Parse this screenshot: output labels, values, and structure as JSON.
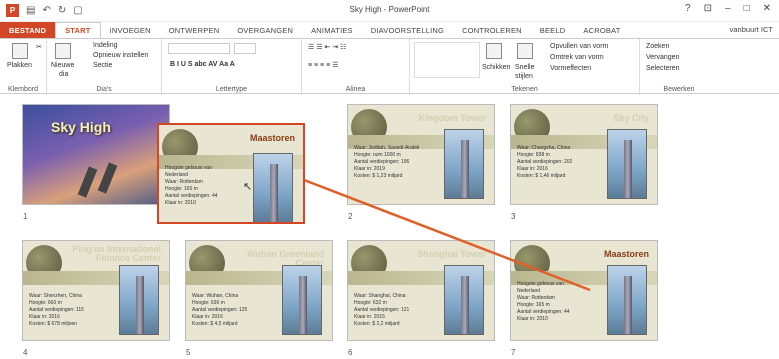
{
  "window": {
    "title": "Sky High - PowerPoint",
    "user": "vanbuurt ICT"
  },
  "tabs": [
    {
      "label": "BESTAND"
    },
    {
      "label": "START"
    },
    {
      "label": "INVOEGEN"
    },
    {
      "label": "ONTWERPEN"
    },
    {
      "label": "OVERGANGEN"
    },
    {
      "label": "ANIMATIES"
    },
    {
      "label": "DIAVOORSTELLING"
    },
    {
      "label": "CONTROLEREN"
    },
    {
      "label": "BEELD"
    },
    {
      "label": "ACROBAT"
    }
  ],
  "ribbon": {
    "klembord": {
      "label": "Klembord",
      "plakken": "Plakken"
    },
    "dias": {
      "label": "Dia's",
      "nieuwe": "Nieuwe",
      "dia": "dia",
      "indeling": "Indeling",
      "opnieuw": "Opnieuw instellen",
      "sectie": "Sectie"
    },
    "lettertype": {
      "label": "Lettertype"
    },
    "alinea": {
      "label": "Alinea"
    },
    "tekenen": {
      "label": "Tekenen",
      "schikken": "Schikken",
      "snelle": "Snelle",
      "stijlen": "stijlen",
      "opvullen": "Opvullen van vorm",
      "omtrek": "Omtrek van vorm",
      "effecten": "Vormeffecten"
    },
    "bewerken": {
      "label": "Bewerken",
      "zoeken": "Zoeken",
      "vervangen": "Vervangen",
      "selecteren": "Selecteren"
    }
  },
  "slides": [
    {
      "num": "1",
      "title": "Sky High"
    },
    {
      "num": "2",
      "title": "Kingdom Tower",
      "bullets": [
        "Waar: Jeddah, Saoedi-Arabië",
        "Hoogte: ruim 1000 m",
        "Aantal verdiepingen: 196",
        "Klaar in: 2019",
        "Kosten: $ 1,23 miljard"
      ]
    },
    {
      "num": "3",
      "title": "Sky City",
      "bullets": [
        "Waar: Changsha, China",
        "Hoogte: 838 m",
        "Aantal verdiepingen: 202",
        "Klaar in: 2016",
        "Kosten: $ 1,46 miljard"
      ]
    },
    {
      "num": "4",
      "title": "Ping'an International Finance Center",
      "bullets": [
        "Waar: Shenzhen, China",
        "Hoogte: 660 m",
        "Aantal verdiepingen: 115",
        "Klaar in: 2016",
        "Kosten: $ 678 miljoen"
      ]
    },
    {
      "num": "5",
      "title": "Wuhan Greenland Center",
      "bullets": [
        "Waar: Wuhan, China",
        "Hoogte: 636 m",
        "Aantal verdiepingen: 125",
        "Klaar in: 2016",
        "Kosten: $ 4,5 miljard"
      ]
    },
    {
      "num": "6",
      "title": "Shanghai Tower",
      "bullets": [
        "Waar: Shanghai, China",
        "Hoogte: 632 m",
        "Aantal verdiepingen: 121",
        "Klaar in: 2015",
        "Kosten: $ 2,2 miljard"
      ]
    },
    {
      "num": "7",
      "title": "Maastoren",
      "bullets": [
        "Hoogste gebouw van Nederland",
        "Waar: Rotterdam",
        "Hoogte: 165 m",
        "Aantal verdiepingen: 44",
        "Klaar in: 2010"
      ]
    }
  ],
  "dragged": {
    "title": "Maastoren",
    "bullets": [
      "Hoogste gebouw van Nederland",
      "Waar: Rotterdam",
      "Hoogte: 165 m",
      "Aantal verdiepingen: 44",
      "Klaar in: 2010"
    ]
  }
}
